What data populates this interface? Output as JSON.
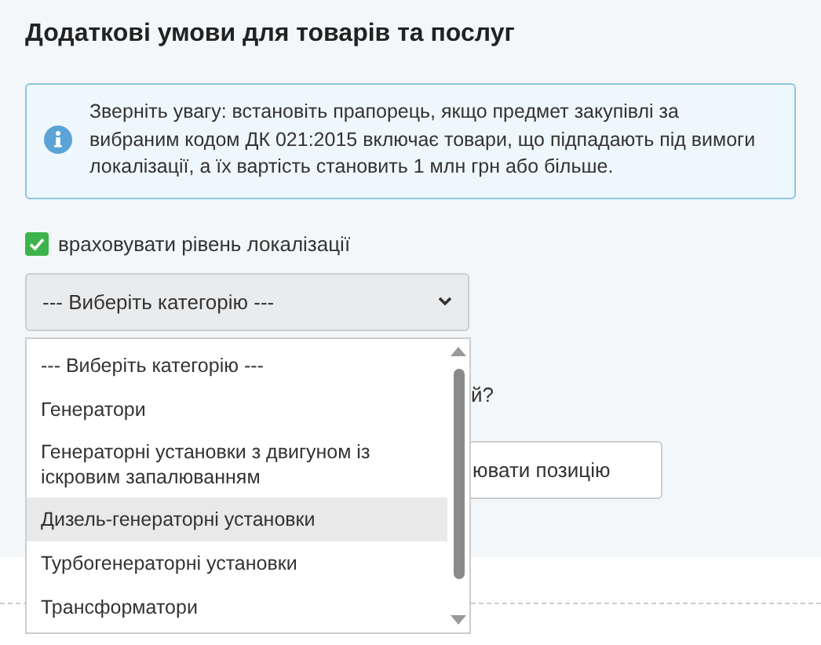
{
  "heading": "Додаткові умови для товарів та послуг",
  "notice": "Зверніть увагу: встановіть прапорець, якщо предмет закупівлі за вибраним кодом ДК 021:2015 включає товари, що підпадають під вимоги локалізації, а їх вартість становить 1 млн грн або більше.",
  "localization": {
    "label": "враховувати рівень локалізації",
    "checked": true
  },
  "category_select": {
    "value": "--- Виберіть категорію ---",
    "expanded": true,
    "options": [
      {
        "label": "--- Виберіть категорію ---",
        "highlighted": false
      },
      {
        "label": "Генератори",
        "highlighted": false
      },
      {
        "label": "Генераторні установки з двигуном із іскровим запалюванням",
        "highlighted": false
      },
      {
        "label": "Дизель-генераторні установки",
        "highlighted": true
      },
      {
        "label": "Турбогенераторні установки",
        "highlighted": false
      },
      {
        "label": "Трансформатори",
        "highlighted": false
      }
    ]
  },
  "question_fragment": "й?",
  "button_fragment": "ювати позицію"
}
